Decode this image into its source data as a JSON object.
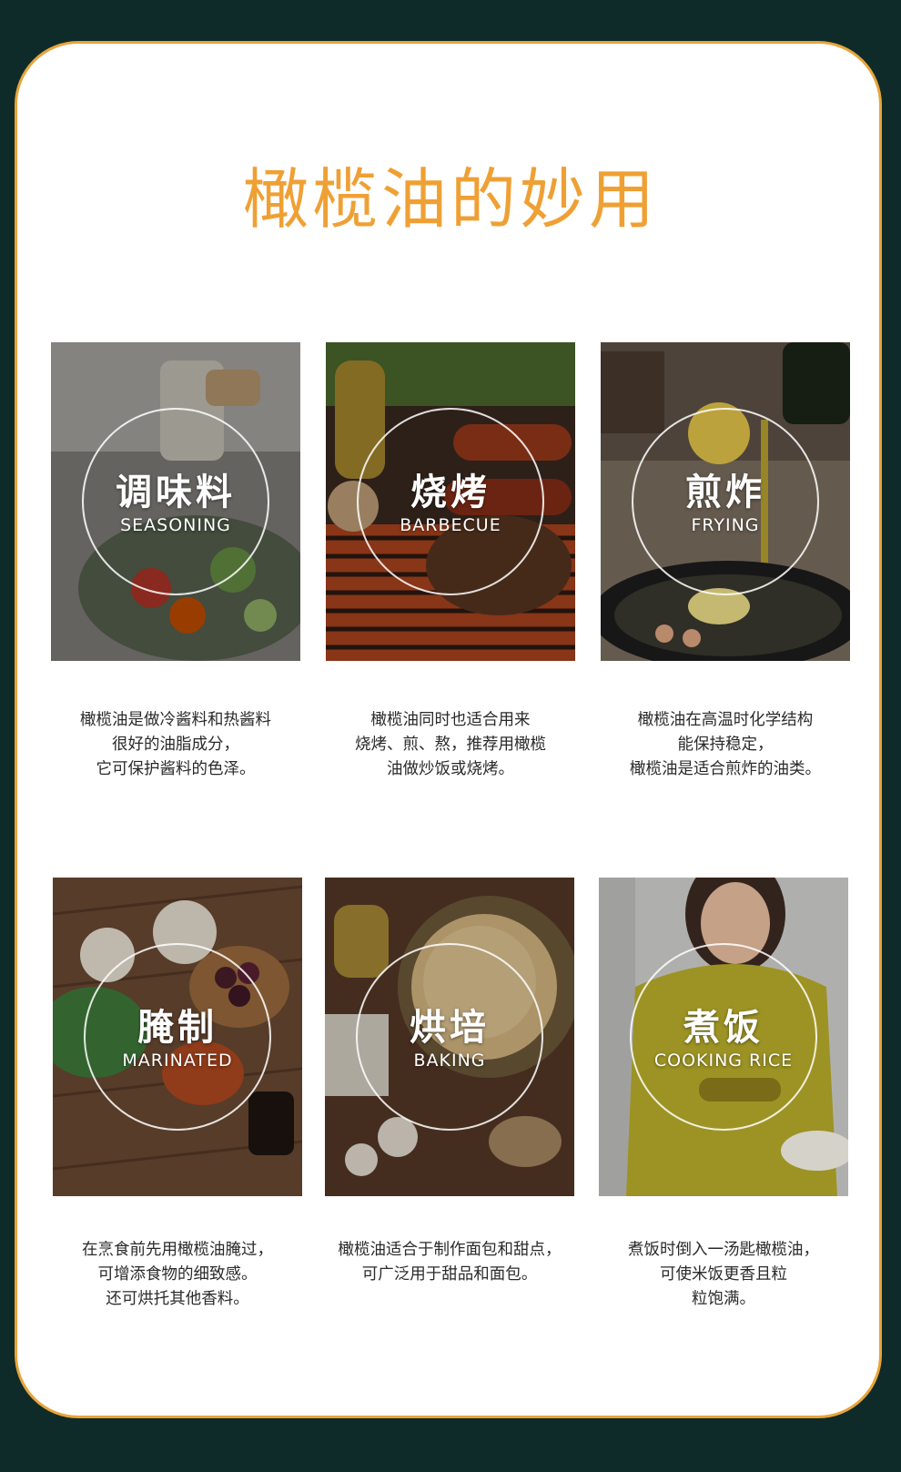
{
  "title": "橄榄油的妙用",
  "colors": {
    "accent": "#efa034",
    "background": "#0f2b29",
    "card": "#ffffff",
    "text": "#2a2a2a"
  },
  "items": [
    {
      "cn": "调味料",
      "en": "SEASONING",
      "desc": [
        "橄榄油是做冷酱料和热酱料",
        "很好的油脂成分，",
        "它可保护酱料的色泽。"
      ]
    },
    {
      "cn": "烧烤",
      "en": "BARBECUE",
      "desc": [
        "橄榄油同时也适合用来",
        "烧烤、煎、熬，推荐用橄榄",
        "油做炒饭或烧烤。"
      ]
    },
    {
      "cn": "煎炸",
      "en": "FRYING",
      "desc": [
        "橄榄油在高温时化学结构",
        "能保持稳定，",
        "橄榄油是适合煎炸的油类。"
      ]
    },
    {
      "cn": "腌制",
      "en": "MARINATED",
      "desc": [
        "在烹食前先用橄榄油腌过，",
        "可增添食物的细致感。",
        "还可烘托其他香料。"
      ]
    },
    {
      "cn": "烘培",
      "en": "BAKING",
      "desc": [
        "橄榄油适合于制作面包和甜点，",
        "可广泛用于甜品和面包。"
      ]
    },
    {
      "cn": "煮饭",
      "en": "COOKING RICE",
      "desc": [
        "煮饭时倒入一汤匙橄榄油，",
        "可使米饭更香且粒",
        "粒饱满。"
      ]
    }
  ]
}
